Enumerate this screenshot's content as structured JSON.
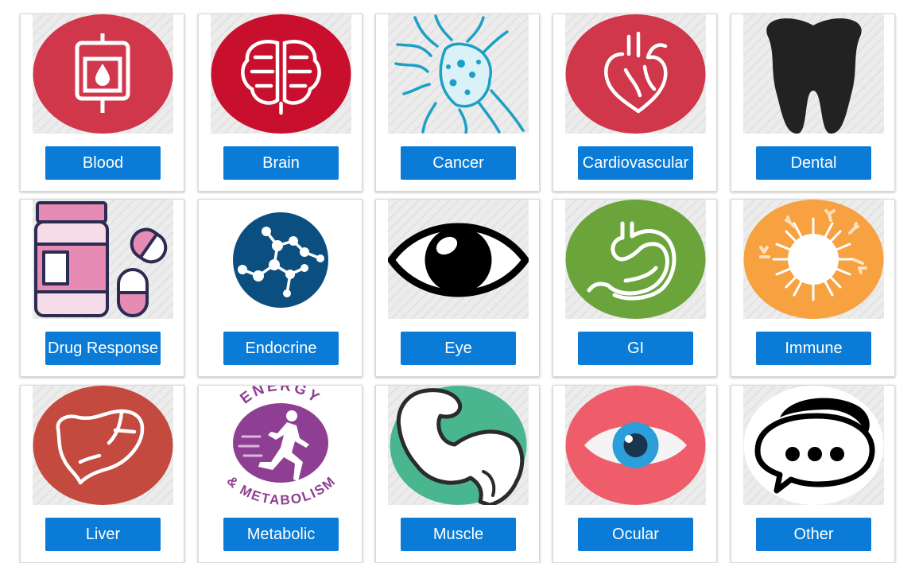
{
  "categories": [
    {
      "label": "Blood",
      "icon": "blood-bag-icon",
      "color": "#d0374a"
    },
    {
      "label": "Brain",
      "icon": "brain-icon",
      "color": "#c8102e"
    },
    {
      "label": "Cancer",
      "icon": "cancer-cell-icon",
      "color": "#1ca0c5"
    },
    {
      "label": "Cardiovascular",
      "icon": "heart-icon",
      "color": "#d0374a"
    },
    {
      "label": "Dental",
      "icon": "tooth-icon",
      "color": "#222222"
    },
    {
      "label": "Drug Response",
      "icon": "pill-bottle-icon",
      "color": "#e58bb4"
    },
    {
      "label": "Endocrine",
      "icon": "molecule-icon",
      "color": "#0b4f80"
    },
    {
      "label": "Eye",
      "icon": "eye-icon",
      "color": "#000000"
    },
    {
      "label": "GI",
      "icon": "stomach-icon",
      "color": "#6ba43a"
    },
    {
      "label": "Immune",
      "icon": "immune-cell-icon",
      "color": "#f7a140"
    },
    {
      "label": "Liver",
      "icon": "liver-icon",
      "color": "#c44a3f"
    },
    {
      "label": "Metabolic",
      "icon": "energy-metabolism-logo",
      "color": "#8e3f93",
      "logo_text": [
        "ENERGY",
        "& METABOLISM"
      ]
    },
    {
      "label": "Muscle",
      "icon": "flexed-arm-icon",
      "color": "#49b68f"
    },
    {
      "label": "Ocular",
      "icon": "eye-color-icon",
      "color": "#ef5d6a"
    },
    {
      "label": "Other",
      "icon": "speech-bubble-icon",
      "color": "#000000"
    }
  ]
}
